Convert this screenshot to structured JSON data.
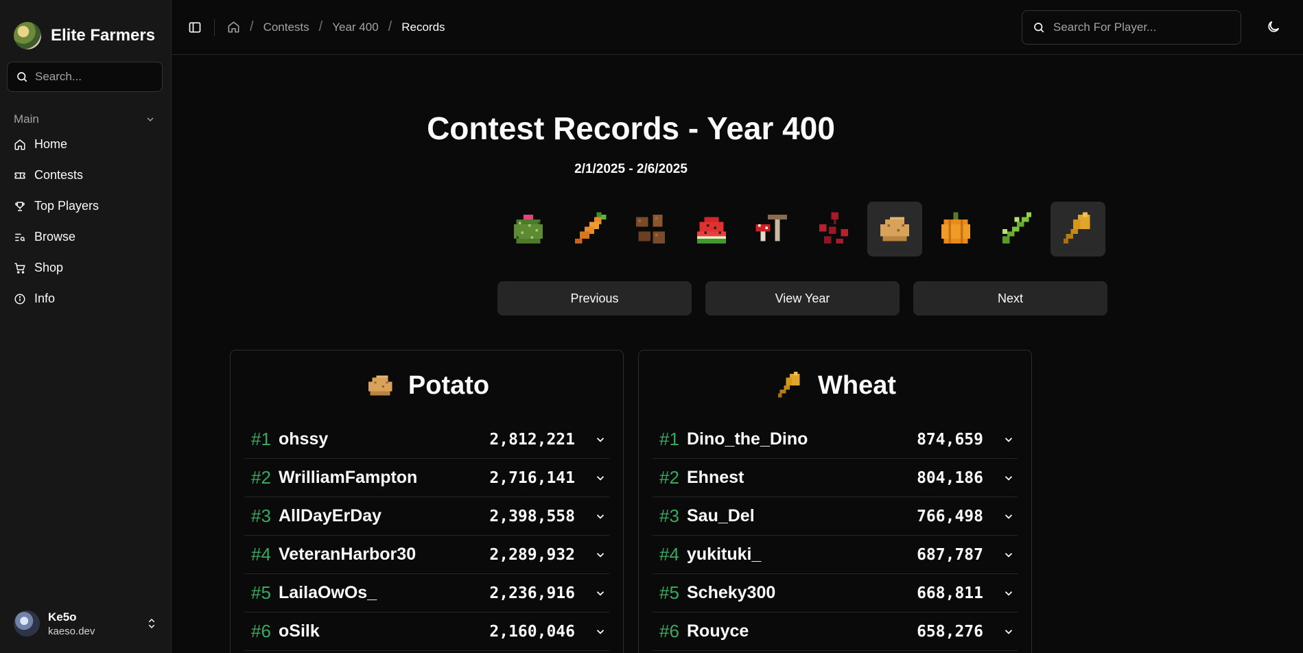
{
  "brand": {
    "name": "Elite Farmers"
  },
  "sidebar": {
    "search_placeholder": "Search...",
    "group_label": "Main",
    "items": [
      {
        "label": "Home",
        "icon": "home-icon"
      },
      {
        "label": "Contests",
        "icon": "ticket-icon"
      },
      {
        "label": "Top Players",
        "icon": "trophy-icon"
      },
      {
        "label": "Browse",
        "icon": "browse-icon"
      },
      {
        "label": "Shop",
        "icon": "cart-icon"
      },
      {
        "label": "Info",
        "icon": "info-icon"
      }
    ],
    "user": {
      "name": "Ke5o",
      "subtitle": "kaeso.dev"
    }
  },
  "breadcrumb": {
    "items": [
      "Contests",
      "Year 400"
    ],
    "current": "Records"
  },
  "player_search": {
    "placeholder": "Search For Player..."
  },
  "page": {
    "title": "Contest Records - Year 400",
    "dates": "2/1/2025 - 2/6/2025"
  },
  "crops": [
    {
      "name": "cactus",
      "selected": false
    },
    {
      "name": "carrot",
      "selected": false
    },
    {
      "name": "cocoa-beans",
      "selected": false
    },
    {
      "name": "melon",
      "selected": false
    },
    {
      "name": "mushroom",
      "selected": false
    },
    {
      "name": "nether-wart",
      "selected": false
    },
    {
      "name": "potato",
      "selected": true
    },
    {
      "name": "pumpkin",
      "selected": false
    },
    {
      "name": "sugar-cane",
      "selected": false
    },
    {
      "name": "wheat",
      "selected": true
    }
  ],
  "buttons": {
    "previous": "Previous",
    "view_year": "View Year",
    "next": "Next"
  },
  "cards": [
    {
      "crop": "Potato",
      "rows": [
        {
          "rank": "#1",
          "name": "ohssy",
          "score": "2,812,221"
        },
        {
          "rank": "#2",
          "name": "WrilliamFampton",
          "score": "2,716,141"
        },
        {
          "rank": "#3",
          "name": "AllDayErDay",
          "score": "2,398,558"
        },
        {
          "rank": "#4",
          "name": "VeteranHarbor30",
          "score": "2,289,932"
        },
        {
          "rank": "#5",
          "name": "LailaOwOs_",
          "score": "2,236,916"
        },
        {
          "rank": "#6",
          "name": "oSilk",
          "score": "2,160,046"
        }
      ]
    },
    {
      "crop": "Wheat",
      "rows": [
        {
          "rank": "#1",
          "name": "Dino_the_Dino",
          "score": "874,659"
        },
        {
          "rank": "#2",
          "name": "Ehnest",
          "score": "804,186"
        },
        {
          "rank": "#3",
          "name": "Sau_Del",
          "score": "766,498"
        },
        {
          "rank": "#4",
          "name": "yukituki_",
          "score": "687,787"
        },
        {
          "rank": "#5",
          "name": "Scheky300",
          "score": "668,811"
        },
        {
          "rank": "#6",
          "name": "Rouyce",
          "score": "658,276"
        }
      ]
    }
  ],
  "colors": {
    "rank_green": "#3aa860",
    "background": "#0a0a0a",
    "sidebar": "#171717"
  }
}
